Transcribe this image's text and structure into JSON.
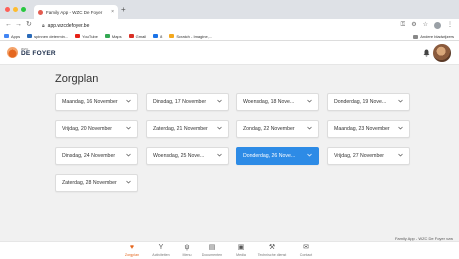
{
  "browser": {
    "tab_title": "Family App - WZC De Foyer",
    "tab_close": "×",
    "new_tab": "+",
    "url": "app.wzcdefoyer.be",
    "bookmarks": [
      {
        "label": "Apps",
        "color": "#4285f4"
      },
      {
        "label": "spinnen determin...",
        "color": "#2a6ab8"
      },
      {
        "label": "YouTube",
        "color": "#e62117"
      },
      {
        "label": "Maps",
        "color": "#34a853"
      },
      {
        "label": "Gmail",
        "color": "#d93025"
      },
      {
        "label": "8",
        "color": "#1a73e8"
      },
      {
        "label": "Scratch - Imagine,...",
        "color": "#f4a81d"
      }
    ],
    "other_bookmarks": "Andere bladwijzers"
  },
  "header": {
    "logo_small": "WZC",
    "logo_big": "DE FOYER",
    "bell_icon": "bell-icon"
  },
  "page": {
    "title": "Zorgplan",
    "selected_color": "#2d8be6"
  },
  "dates": [
    {
      "label": "Maandag, 16 November"
    },
    {
      "label": "Dinsdag, 17 November"
    },
    {
      "label": "Woensdag, 18 Nove..."
    },
    {
      "label": "Donderdag, 19 Nove..."
    },
    {
      "label": "Vrijdag, 20 November"
    },
    {
      "label": "Zaterdag, 21 November"
    },
    {
      "label": "Zondag, 22 November"
    },
    {
      "label": "Maandag, 23 November"
    },
    {
      "label": "Dinsdag, 24 November"
    },
    {
      "label": "Woensdag, 25 Nove..."
    },
    {
      "label": "Donderdag, 26 Nove...",
      "selected": true
    },
    {
      "label": "Vrijdag, 27 November"
    },
    {
      "label": "Zaterdag, 28 November"
    }
  ],
  "footer_note": "Family App - WZC De Foyer vzw",
  "bottom_nav": [
    {
      "label": "Zorgplan",
      "icon": "heart-icon",
      "active": true
    },
    {
      "label": "Activiteiten",
      "icon": "activity-icon"
    },
    {
      "label": "Menu",
      "icon": "cutlery-icon"
    },
    {
      "label": "Documenten",
      "icon": "document-icon"
    },
    {
      "label": "Media",
      "icon": "media-icon"
    },
    {
      "label": "Technische dienst",
      "icon": "wrench-icon"
    },
    {
      "label": "Contact",
      "icon": "mail-icon"
    }
  ],
  "accent_color": "#e5671f"
}
